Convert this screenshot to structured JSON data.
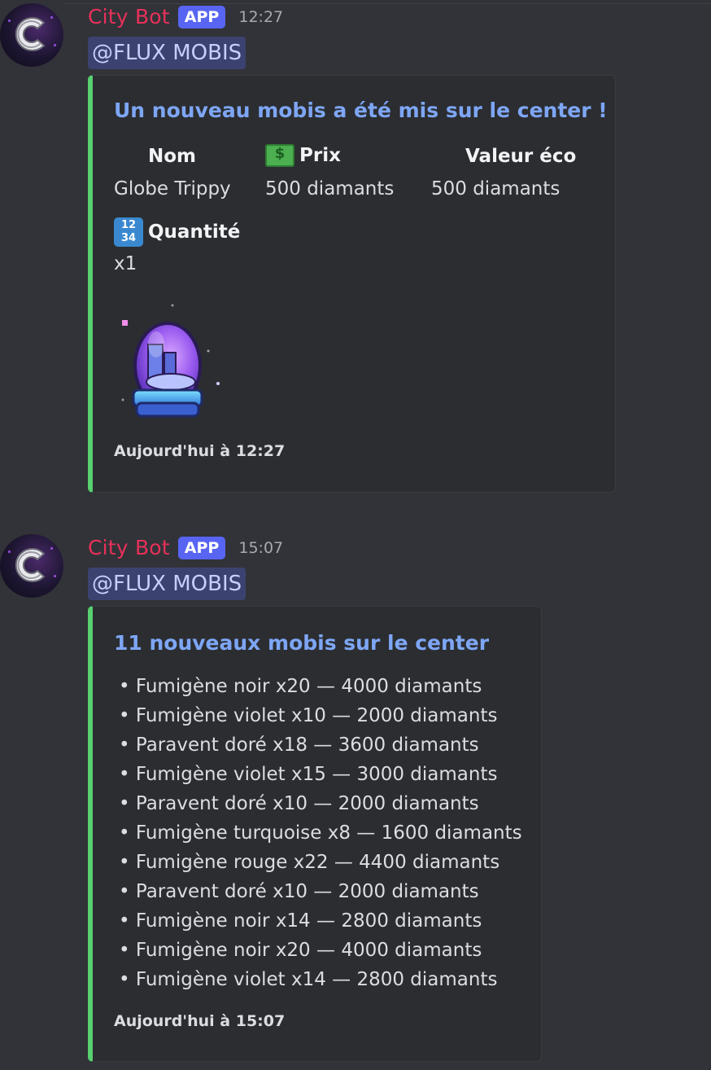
{
  "messages": [
    {
      "author": "City Bot",
      "badge": "APP",
      "time": "12:27",
      "mention": "@FLUX MOBIS",
      "embed": {
        "title": "Un nouveau mobis a été mis sur le center !",
        "fields": [
          {
            "name": "Nom",
            "value": "Globe Trippy",
            "icon": ""
          },
          {
            "name": "Prix",
            "value": "500 diamants",
            "icon": "money-icon"
          },
          {
            "name": "Valeur éco",
            "value": "500 diamants",
            "icon": ""
          },
          {
            "name": "Quantité",
            "value": "x1",
            "icon": "numbers-icon"
          }
        ],
        "image": "globe-trippy-snowglobe",
        "footer": "Aujourd'hui à 12:27"
      }
    },
    {
      "author": "City Bot",
      "badge": "APP",
      "time": "15:07",
      "mention": "@FLUX MOBIS",
      "embed": {
        "title": "11 nouveaux mobis sur le center",
        "items": [
          "• Fumigène noir x20 — 4000 diamants",
          "• Fumigène violet x10 — 2000 diamants",
          "• Paravent doré x18 — 3600 diamants",
          "• Fumigène violet x15 — 3000 diamants",
          "• Paravent doré x10 — 2000 diamants",
          "• Fumigène turquoise x8 — 1600 diamants",
          "• Fumigène rouge x22 — 4400 diamants",
          "• Paravent doré x10 — 2000 diamants",
          "• Fumigène noir x14 — 2800 diamants",
          "• Fumigène noir x20 — 4000 diamants",
          "• Fumigène violet x14 — 2800 diamants"
        ],
        "footer": "Aujourd'hui à 15:07"
      }
    }
  ],
  "colors": {
    "background": "#313338",
    "embed_bg": "#2b2d31",
    "embed_accent": "#57d06f",
    "author": "#e8305a",
    "badge": "#5865f2",
    "title": "#7ea6f5"
  }
}
